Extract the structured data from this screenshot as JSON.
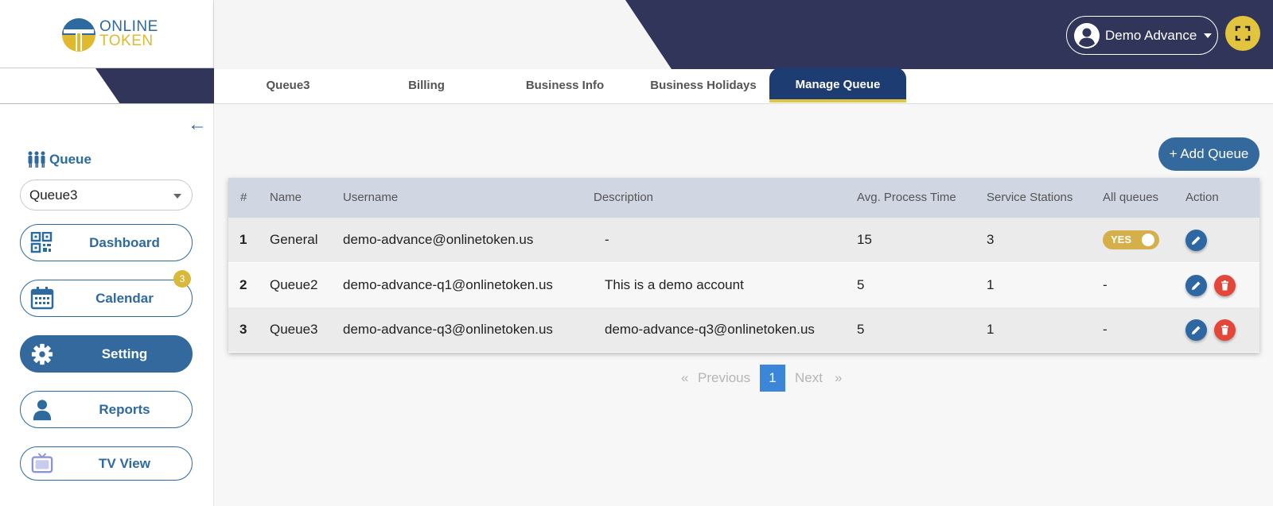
{
  "brand": {
    "line1": "ONLINE",
    "line2": "TOKEN"
  },
  "header": {
    "user_name": "Demo Advance"
  },
  "tabs": [
    {
      "label": "Queue3"
    },
    {
      "label": "Billing"
    },
    {
      "label": "Business Info"
    },
    {
      "label": "Business Holidays"
    },
    {
      "label": "Manage Queue",
      "active": true
    }
  ],
  "sidebar": {
    "queue_label": "Queue",
    "queue_selected": "Queue3",
    "calendar_badge": "3",
    "items": [
      {
        "label": "Dashboard",
        "icon": "qr-code-icon"
      },
      {
        "label": "Calendar",
        "icon": "calendar-icon"
      },
      {
        "label": "Setting",
        "icon": "gear-icon",
        "active": true
      },
      {
        "label": "Reports",
        "icon": "person-icon"
      },
      {
        "label": "TV View",
        "icon": "tv-icon"
      }
    ]
  },
  "main": {
    "add_button": "+ Add Queue",
    "columns": [
      "#",
      "Name",
      "Username",
      "Description",
      "Avg. Process Time",
      "Service Stations",
      "All queues",
      "Action"
    ],
    "rows": [
      {
        "num": "1",
        "name": "General",
        "username": "demo-advance@onlinetoken.us",
        "description": "-",
        "avg_time": "15",
        "stations": "3",
        "all_queues": "YES"
      },
      {
        "num": "2",
        "name": "Queue2",
        "username": "demo-advance-q1@onlinetoken.us",
        "description": "This is a demo account",
        "avg_time": "5",
        "stations": "1",
        "all_queues": "-"
      },
      {
        "num": "3",
        "name": "Queue3",
        "username": "demo-advance-q3@onlinetoken.us",
        "description": "demo-advance-q3@onlinetoken.us",
        "avg_time": "5",
        "stations": "1",
        "all_queues": "-"
      }
    ]
  },
  "pagination": {
    "prev_arrow": "«",
    "previous": "Previous",
    "current": "1",
    "next": "Next",
    "next_arrow": "»"
  },
  "colors": {
    "primary": "#33699c",
    "navy": "#1d3d72",
    "accent": "#e2c43e",
    "danger": "#e4463a",
    "header_dark": "#31355a"
  }
}
